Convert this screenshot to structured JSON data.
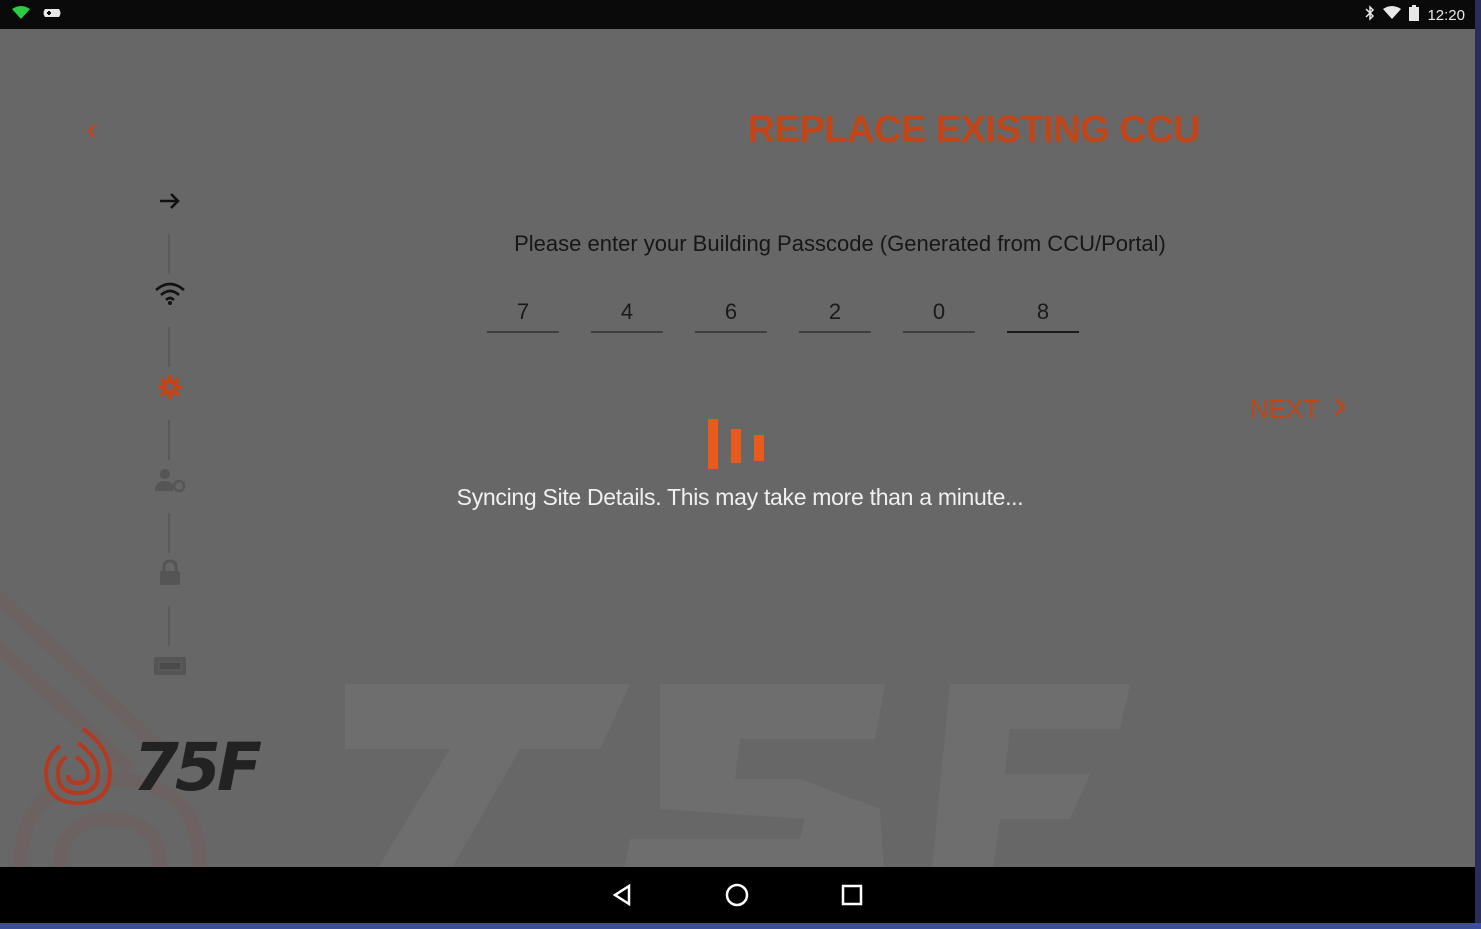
{
  "status_bar": {
    "time": "12:20",
    "left_icons": [
      "wifi-green-icon",
      "game-controller-icon"
    ],
    "right_icons": [
      "bluetooth-icon",
      "wifi-icon",
      "battery-icon"
    ]
  },
  "header": {
    "title": "REPLACE EXISTING CCU",
    "back_icon": "chevron-left-icon"
  },
  "stepper": {
    "steps": [
      {
        "icon": "arrow-right-icon",
        "state": "done"
      },
      {
        "icon": "wifi-icon",
        "state": "done"
      },
      {
        "icon": "gear-icon",
        "state": "active"
      },
      {
        "icon": "user-settings-icon",
        "state": "pending"
      },
      {
        "icon": "lock-icon",
        "state": "pending"
      },
      {
        "icon": "device-icon",
        "state": "pending"
      }
    ]
  },
  "passcode": {
    "prompt": "Please enter your Building Passcode (Generated from CCU/Portal)",
    "digits": [
      "7",
      "4",
      "6",
      "2",
      "0",
      "8"
    ]
  },
  "next": {
    "label": "NEXT",
    "icon": "chevron-right-icon"
  },
  "sync": {
    "message": "Syncing Site Details. This may take more than a minute..."
  },
  "brand": {
    "logo_text": "75F"
  },
  "navigation": {
    "buttons": [
      "back-triangle-icon",
      "home-circle-icon",
      "recents-square-icon"
    ]
  },
  "colors": {
    "accent": "#c0461a",
    "loader": "#e95b1c",
    "background": "#676767"
  }
}
